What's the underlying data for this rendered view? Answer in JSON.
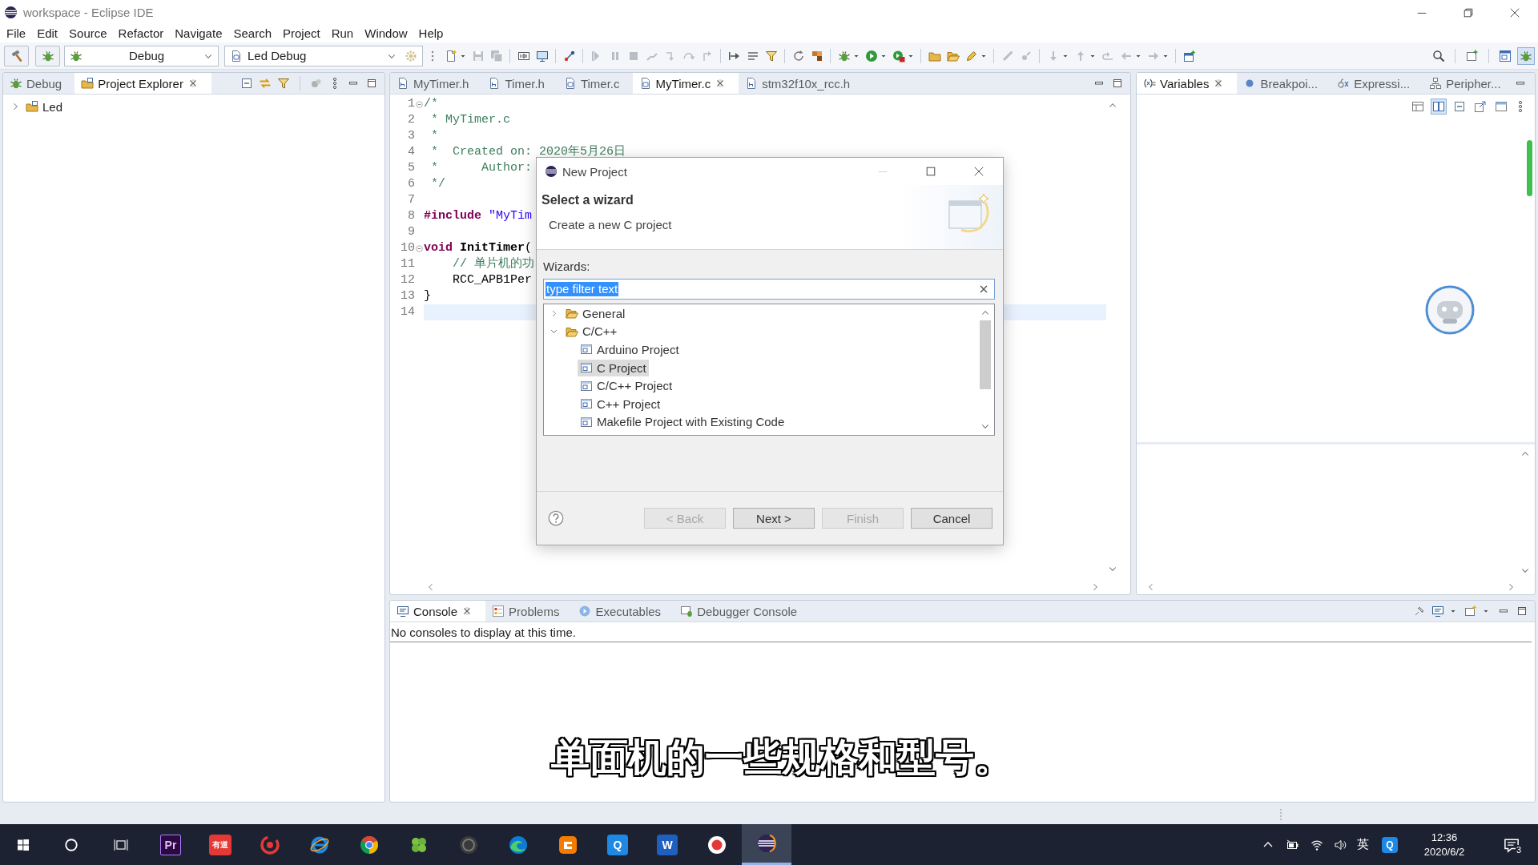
{
  "window": {
    "title": "workspace - Eclipse IDE"
  },
  "menu": [
    "File",
    "Edit",
    "Source",
    "Refactor",
    "Navigate",
    "Search",
    "Project",
    "Run",
    "Window",
    "Help"
  ],
  "toolbar": {
    "launch_mode": "Debug",
    "launch_config": "Led Debug",
    "perspectives": [
      {
        "selected": false
      },
      {
        "selected": true
      }
    ]
  },
  "left_panel": {
    "tabs": [
      {
        "label": "Debug",
        "selected": false
      },
      {
        "label": "Project Explorer",
        "selected": true
      }
    ],
    "tree": [
      {
        "label": "Led",
        "expanded": false,
        "selected": false
      }
    ]
  },
  "editor": {
    "tabs": [
      {
        "label": "MyTimer.h",
        "selected": false
      },
      {
        "label": "Timer.h",
        "selected": false
      },
      {
        "label": "Timer.c",
        "selected": false
      },
      {
        "label": "MyTimer.c",
        "selected": true
      },
      {
        "label": "stm32f10x_rcc.h",
        "selected": false
      }
    ],
    "lines": [
      {
        "number": "1",
        "fold_marker": true,
        "current": false,
        "tokens": [
          {
            "kind": "comment",
            "text": "/*"
          }
        ]
      },
      {
        "number": "2",
        "fold_marker": false,
        "current": false,
        "tokens": [
          {
            "kind": "comment",
            "text": " * MyTimer.c"
          }
        ]
      },
      {
        "number": "3",
        "fold_marker": false,
        "current": false,
        "tokens": [
          {
            "kind": "comment",
            "text": " *"
          }
        ]
      },
      {
        "number": "4",
        "fold_marker": false,
        "current": false,
        "tokens": [
          {
            "kind": "comment",
            "text": " *  Created on: 2020年5月26日"
          }
        ]
      },
      {
        "number": "5",
        "fold_marker": false,
        "current": false,
        "tokens": [
          {
            "kind": "comment",
            "text": " *      Author:"
          }
        ]
      },
      {
        "number": "6",
        "fold_marker": false,
        "current": false,
        "tokens": [
          {
            "kind": "comment",
            "text": " */"
          }
        ]
      },
      {
        "number": "7",
        "fold_marker": false,
        "current": false
      },
      {
        "number": "8",
        "fold_marker": false,
        "current": false,
        "tokens": [
          {
            "kind": "keyword",
            "text": "#include "
          },
          {
            "kind": "string",
            "text": "\"MyTim"
          }
        ]
      },
      {
        "number": "9",
        "fold_marker": false,
        "current": false
      },
      {
        "number": "10",
        "fold_marker": true,
        "current": false,
        "tokens": [
          {
            "kind": "keyword",
            "text": "void "
          },
          {
            "kind": "function",
            "text": "InitTimer"
          },
          {
            "kind": "plain",
            "text": "("
          }
        ]
      },
      {
        "number": "11",
        "fold_marker": false,
        "current": false,
        "tokens": [
          {
            "kind": "comment",
            "text": "    // 单片机的功"
          }
        ]
      },
      {
        "number": "12",
        "fold_marker": false,
        "current": false,
        "tokens": [
          {
            "kind": "plain",
            "text": "    RCC_APB1Per"
          }
        ]
      },
      {
        "number": "13",
        "fold_marker": false,
        "current": false,
        "tokens": [
          {
            "kind": "plain",
            "text": "}"
          }
        ]
      },
      {
        "number": "14",
        "fold_marker": false,
        "current": true
      }
    ]
  },
  "right_panel": {
    "tabs": [
      {
        "label": "Variables",
        "selected": true
      },
      {
        "label": "Breakpoi...",
        "selected": false
      },
      {
        "label": "Expressi...",
        "selected": false
      },
      {
        "label": "Peripher...",
        "selected": false
      }
    ],
    "view_toggles": [
      {
        "selected": false
      },
      {
        "selected": true
      },
      {
        "selected": false
      },
      {
        "selected": false
      },
      {
        "selected": false
      }
    ]
  },
  "console": {
    "tabs": [
      {
        "label": "Console",
        "selected": true
      },
      {
        "label": "Problems",
        "selected": false
      },
      {
        "label": "Executables",
        "selected": false
      },
      {
        "label": "Debugger Console",
        "selected": false
      }
    ],
    "message": "No consoles to display at this time."
  },
  "dialog": {
    "title": "New Project",
    "heading": "Select a wizard",
    "description": "Create a new C project",
    "filter_label": "Wizards:",
    "filter": {
      "value": "type filter text",
      "text_selected": true
    },
    "tree": [
      {
        "label": "General",
        "expanded": false,
        "selected": false
      },
      {
        "label": "C/C++",
        "expanded": true,
        "selected": false,
        "children": [
          {
            "label": "Arduino Project",
            "selected": false
          },
          {
            "label": "C Project",
            "selected": true
          },
          {
            "label": "C/C++ Project",
            "selected": false
          },
          {
            "label": "C++ Project",
            "selected": false
          },
          {
            "label": "Makefile Project with Existing Code",
            "selected": false
          }
        ]
      }
    ],
    "buttons": [
      {
        "label": "< Back",
        "disabled": true
      },
      {
        "label": "Next >",
        "disabled": false
      },
      {
        "label": "Finish",
        "disabled": true
      },
      {
        "label": "Cancel",
        "disabled": false
      }
    ]
  },
  "subtitle": "单面机的一些规格和型号。",
  "taskbar": {
    "apps": [
      {
        "kind": "premiere",
        "glyph": "Pr",
        "selected": false
      },
      {
        "kind": "youdao",
        "glyph": "有道",
        "selected": false
      },
      {
        "kind": "spiral",
        "selected": false
      },
      {
        "kind": "ie",
        "selected": false
      },
      {
        "kind": "chrome",
        "selected": false
      },
      {
        "kind": "clover",
        "selected": false
      },
      {
        "kind": "disc",
        "selected": false
      },
      {
        "kind": "edge",
        "selected": false
      },
      {
        "kind": "orange",
        "selected": false
      },
      {
        "kind": "qbox",
        "glyph": "Q",
        "selected": false
      },
      {
        "kind": "word",
        "glyph": "W",
        "selected": false
      },
      {
        "kind": "record",
        "selected": false
      },
      {
        "kind": "eclipse",
        "selected": true
      }
    ],
    "tray": {
      "input_method": "英",
      "app_glyph": "Q",
      "time": "12:36",
      "date": "2020/6/2",
      "notifications": "3"
    }
  }
}
